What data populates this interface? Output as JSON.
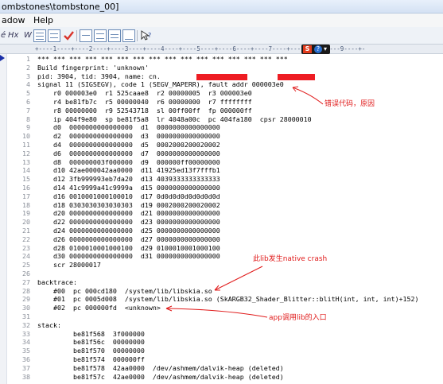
{
  "window": {
    "title": "ombstones\\tombstone_00]"
  },
  "menu": [
    "adow",
    "Help"
  ],
  "toolbar": {
    "hex_label": "Hx",
    "w_label": "W"
  },
  "ruler": {
    "text": "+----1----+----2----+----3----+----4----+----5----+----6----+----7----+----8----+----9----+-"
  },
  "lines": [
    {
      "n": "1",
      "text": "*** *** *** *** *** *** *** *** *** *** *** *** *** *** *** ***"
    },
    {
      "n": "2",
      "text": "Build fingerprint: 'unknown'"
    },
    {
      "n": "3",
      "text": "pid: 3904, tid: 3904, name: cn.             >>> cn.             <<<"
    },
    {
      "n": "4",
      "text": "signal 11 (SIGSEGV), code 1 (SEGV_MAPERR), fault addr 000003e0"
    },
    {
      "n": "5",
      "text": "    r0 000003e0  r1 525caae8  r2 00000005  r3 000003e0"
    },
    {
      "n": "6",
      "text": "    r4 be81fb7c  r5 00000040  r6 00000000  r7 ffffffff"
    },
    {
      "n": "7",
      "text": "    r8 00000000  r9 52543718  sl 00ff00ff  fp 000000ff"
    },
    {
      "n": "8",
      "text": "    ip 404f9e80  sp be81f5a8  lr 4048a00c  pc 404fa180  cpsr 28000010"
    },
    {
      "n": "9",
      "text": "    d0  0000000000000000  d1  0000000000000000"
    },
    {
      "n": "10",
      "text": "    d2  0000000000000000  d3  0000000000000000"
    },
    {
      "n": "11",
      "text": "    d4  0000000000000000  d5  0002000200020002"
    },
    {
      "n": "12",
      "text": "    d6  0000000000000000  d7  0000000000000000"
    },
    {
      "n": "13",
      "text": "    d8  000000003f000000  d9  000000ff00000000"
    },
    {
      "n": "14",
      "text": "    d10 42ae000042aa0000  d11 41925ed13f7fffb1"
    },
    {
      "n": "15",
      "text": "    d12 3fb999993eb7da20  d13 4039333333333333"
    },
    {
      "n": "16",
      "text": "    d14 41c9999a41c9999a  d15 0000000000000000"
    },
    {
      "n": "17",
      "text": "    d16 0010001000100010  d17 0d0d0d0d0d0d0d0d"
    },
    {
      "n": "18",
      "text": "    d18 0303030303030303  d19 0002000200020002"
    },
    {
      "n": "19",
      "text": "    d20 0000000000000000  d21 0000000000000000"
    },
    {
      "n": "20",
      "text": "    d22 0000000000000000  d23 0000000000000000"
    },
    {
      "n": "21",
      "text": "    d24 0000000000000000  d25 0000000000000000"
    },
    {
      "n": "22",
      "text": "    d26 0000000000000000  d27 0000000000000000"
    },
    {
      "n": "23",
      "text": "    d28 0100010001000100  d29 0100010001000100"
    },
    {
      "n": "24",
      "text": "    d30 0000000000000000  d31 0000000000000000"
    },
    {
      "n": "25",
      "text": "    scr 28000017"
    },
    {
      "n": "26",
      "text": ""
    },
    {
      "n": "27",
      "text": "backtrace:"
    },
    {
      "n": "28",
      "text": "    #00  pc 000cd180  /system/lib/libskia.so"
    },
    {
      "n": "29",
      "text": "    #01  pc 0005d008  /system/lib/libskia.so (SkARGB32_Shader_Blitter::blitH(int, int, int)+152)"
    },
    {
      "n": "30",
      "text": "    #02  pc 000000fd  <unknown>"
    },
    {
      "n": "31",
      "text": ""
    },
    {
      "n": "32",
      "text": "stack:"
    },
    {
      "n": "33",
      "text": "         be81f568  3f000000"
    },
    {
      "n": "34",
      "text": "         be81f56c  00000000"
    },
    {
      "n": "35",
      "text": "         be81f570  00000000"
    },
    {
      "n": "36",
      "text": "         be81f574  000000ff"
    },
    {
      "n": "37",
      "text": "         be81f578  42aa0000  /dev/ashmem/dalvik-heap (deleted)"
    },
    {
      "n": "38",
      "text": "         be81f57c  42ae0000  /dev/ashmem/dalvik-heap (deleted)"
    }
  ],
  "annotations": {
    "error_code": "错误代码，原因",
    "native_crash": "此lib发生native crash",
    "app_entry": "app调用lib的入口"
  },
  "colors": {
    "annotation": "#e01a1a",
    "redaction": "#ee1d23"
  }
}
